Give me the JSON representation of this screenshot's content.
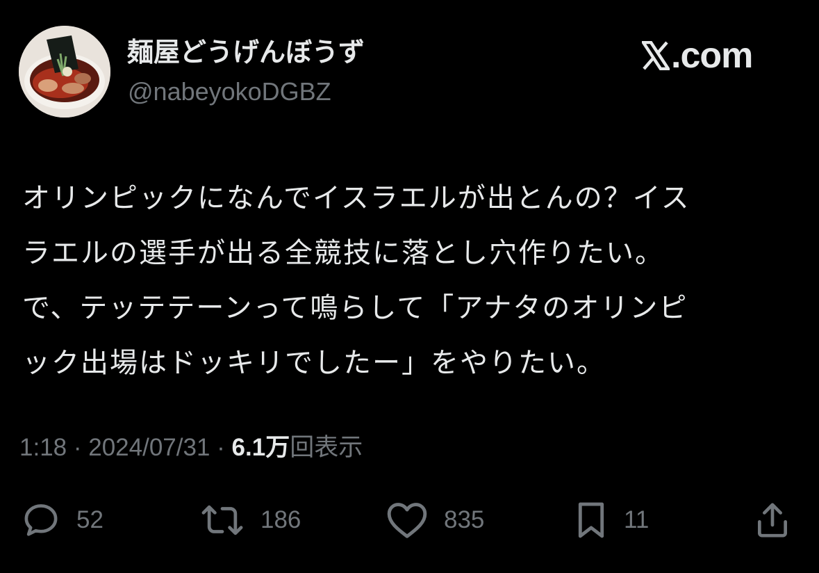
{
  "author": {
    "display_name": "麺屋どうげんぼうず",
    "handle": "@nabeyokoDGBZ",
    "avatar": "ramen-bowl-photo"
  },
  "brand": {
    "logo_text": ".com",
    "logo_icon": "x-logo-icon"
  },
  "tweet": {
    "lines": [
      "オリンピックになんでイスラエルが出とんの？イス",
      "ラエルの選手が出る全競技に落とし穴作りたい。",
      "で、テッテテーンって鳴らして「アナタのオリンピ",
      "ック出場はドッキリでしたー」をやりたい。"
    ]
  },
  "meta": {
    "time": "1:18",
    "separator": "·",
    "date": "2024/07/31",
    "views_count": "6.1万",
    "views_label": "回表示"
  },
  "actions": {
    "replies": "52",
    "reposts": "186",
    "likes": "835",
    "bookmarks": "11"
  },
  "colors": {
    "background": "#000000",
    "text_primary": "#e7e9ea",
    "text_secondary": "#71767b"
  }
}
